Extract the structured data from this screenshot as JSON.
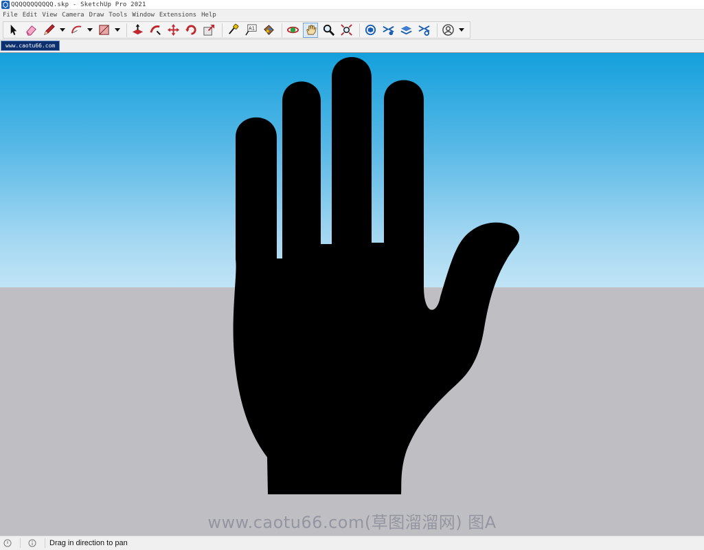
{
  "window": {
    "title": "QQQQQQQQQQQ.skp - SketchUp Pro 2021"
  },
  "menu": [
    "File",
    "Edit",
    "View",
    "Camera",
    "Draw",
    "Tools",
    "Window",
    "Extensions",
    "Help"
  ],
  "toolbar": {
    "tools": [
      {
        "name": "select-tool",
        "icon": "arrow-cursor-icon"
      },
      {
        "name": "eraser-tool",
        "icon": "eraser-icon"
      },
      {
        "name": "pencil-tool",
        "icon": "pencil-icon"
      },
      {
        "name": "arc-tool",
        "icon": "arc-icon"
      },
      {
        "name": "rectangle-tool",
        "icon": "rectangle-icon"
      },
      {
        "name": "push-pull-tool",
        "icon": "push-pull-icon"
      },
      {
        "name": "follow-me-tool",
        "icon": "follow-me-icon"
      },
      {
        "name": "move-tool",
        "icon": "move-icon"
      },
      {
        "name": "rotate-tool",
        "icon": "rotate-icon"
      },
      {
        "name": "scale-tool",
        "icon": "scale-icon"
      },
      {
        "name": "tape-measure-tool",
        "icon": "tape-measure-icon"
      },
      {
        "name": "text-tool",
        "icon": "text-icon"
      },
      {
        "name": "paint-bucket-tool",
        "icon": "paint-bucket-icon"
      },
      {
        "name": "orbit-tool",
        "icon": "orbit-icon"
      },
      {
        "name": "pan-tool",
        "icon": "pan-hand-icon",
        "active": true
      },
      {
        "name": "zoom-tool",
        "icon": "zoom-icon"
      },
      {
        "name": "zoom-extents-tool",
        "icon": "zoom-extents-icon"
      },
      {
        "name": "3d-warehouse-tool",
        "icon": "warehouse-icon"
      },
      {
        "name": "extension-warehouse-tool",
        "icon": "extension-warehouse-icon"
      },
      {
        "name": "layout-send-tool",
        "icon": "layout-icon"
      },
      {
        "name": "extension-manager-tool",
        "icon": "extension-manager-icon"
      },
      {
        "name": "account-tool",
        "icon": "user-account-icon"
      }
    ],
    "text_tool_label": "A1"
  },
  "scenes": {
    "tabs": [
      "www.caotu66.com"
    ]
  },
  "viewport": {
    "sky_color": "#14a0dc",
    "ground_color": "#bfbfc3",
    "model": "hand-silhouette",
    "watermark": "www.caotu66.com(草图溜溜网) 图A"
  },
  "status": {
    "text": "Drag in direction to pan"
  }
}
